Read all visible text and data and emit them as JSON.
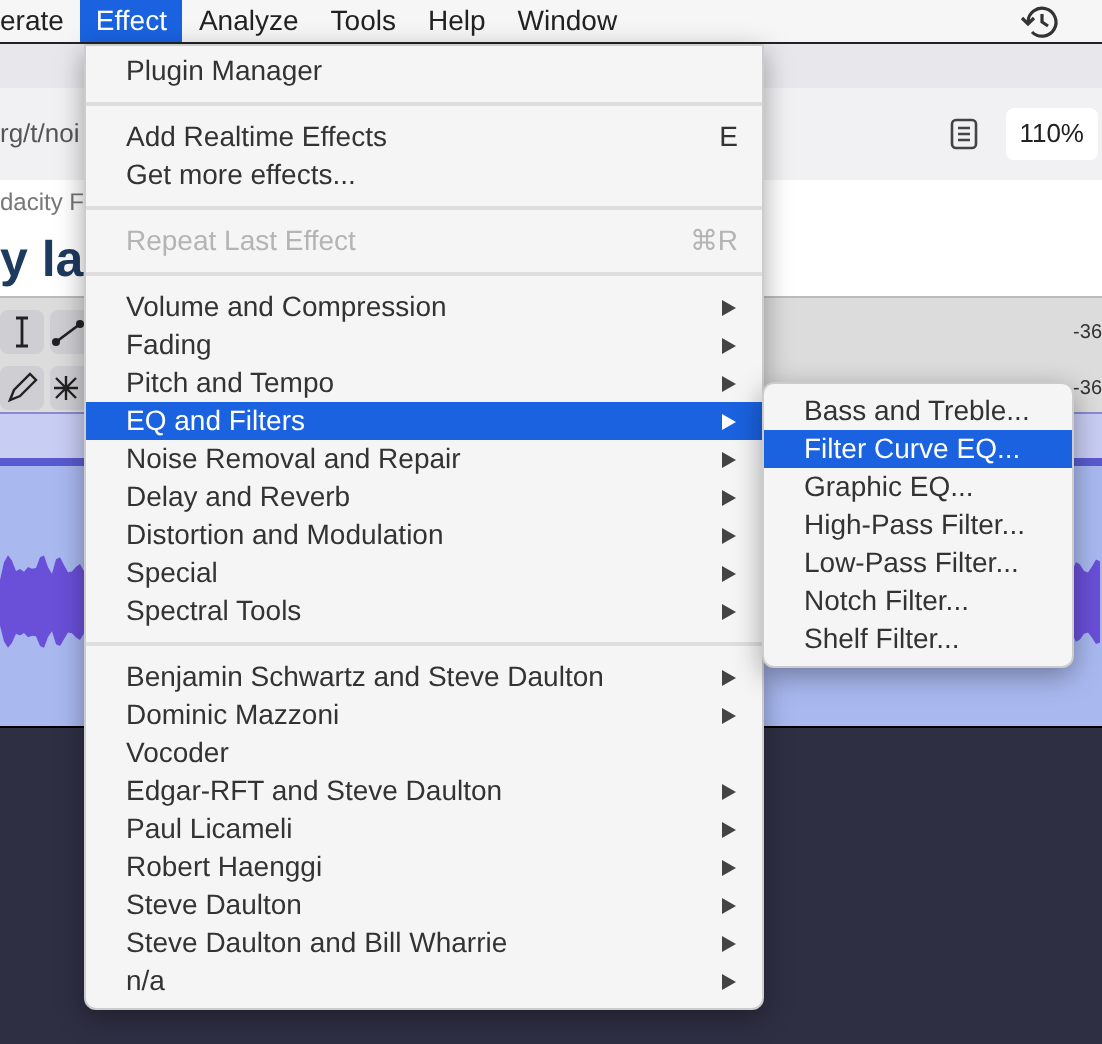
{
  "menubar": [
    {
      "label": "erate",
      "selected": false
    },
    {
      "label": "Effect",
      "selected": true
    },
    {
      "label": "Analyze",
      "selected": false
    },
    {
      "label": "Tools",
      "selected": false
    },
    {
      "label": "Help",
      "selected": false
    },
    {
      "label": "Window",
      "selected": false
    }
  ],
  "browser": {
    "url": "rg/t/noi",
    "zoom": "110%",
    "site_title": "dacity F",
    "heading": "y la"
  },
  "toolbar": {
    "meter_labels": [
      "-36",
      "-36"
    ]
  },
  "effect_menu": [
    {
      "kind": "item",
      "label": "Plugin Manager",
      "disabled": false,
      "submenu": false,
      "selected": false
    },
    {
      "kind": "separator"
    },
    {
      "kind": "item",
      "label": "Add Realtime Effects",
      "shortcut": "E",
      "disabled": false,
      "submenu": false,
      "selected": false
    },
    {
      "kind": "item",
      "label": "Get more effects...",
      "disabled": false,
      "submenu": false,
      "selected": false
    },
    {
      "kind": "separator"
    },
    {
      "kind": "item",
      "label": "Repeat Last Effect",
      "shortcut": "⌘R",
      "disabled": true,
      "submenu": false,
      "selected": false
    },
    {
      "kind": "separator"
    },
    {
      "kind": "item",
      "label": "Volume and Compression",
      "disabled": false,
      "submenu": true,
      "selected": false
    },
    {
      "kind": "item",
      "label": "Fading",
      "disabled": false,
      "submenu": true,
      "selected": false
    },
    {
      "kind": "item",
      "label": "Pitch and Tempo",
      "disabled": false,
      "submenu": true,
      "selected": false
    },
    {
      "kind": "item",
      "label": "EQ and Filters",
      "disabled": false,
      "submenu": true,
      "selected": true
    },
    {
      "kind": "item",
      "label": "Noise Removal and Repair",
      "disabled": false,
      "submenu": true,
      "selected": false
    },
    {
      "kind": "item",
      "label": "Delay and Reverb",
      "disabled": false,
      "submenu": true,
      "selected": false
    },
    {
      "kind": "item",
      "label": "Distortion and Modulation",
      "disabled": false,
      "submenu": true,
      "selected": false
    },
    {
      "kind": "item",
      "label": "Special",
      "disabled": false,
      "submenu": true,
      "selected": false
    },
    {
      "kind": "item",
      "label": "Spectral Tools",
      "disabled": false,
      "submenu": true,
      "selected": false
    },
    {
      "kind": "separator"
    },
    {
      "kind": "item",
      "label": "Benjamin Schwartz and Steve Daulton",
      "disabled": false,
      "submenu": true,
      "selected": false
    },
    {
      "kind": "item",
      "label": "Dominic Mazzoni",
      "disabled": false,
      "submenu": true,
      "selected": false
    },
    {
      "kind": "item",
      "label": "Vocoder",
      "disabled": false,
      "submenu": false,
      "selected": false
    },
    {
      "kind": "item",
      "label": "Edgar-RFT and Steve Daulton",
      "disabled": false,
      "submenu": true,
      "selected": false
    },
    {
      "kind": "item",
      "label": "Paul Licameli",
      "disabled": false,
      "submenu": true,
      "selected": false
    },
    {
      "kind": "item",
      "label": "Robert Haenggi",
      "disabled": false,
      "submenu": true,
      "selected": false
    },
    {
      "kind": "item",
      "label": "Steve Daulton",
      "disabled": false,
      "submenu": true,
      "selected": false
    },
    {
      "kind": "item",
      "label": "Steve Daulton and Bill Wharrie",
      "disabled": false,
      "submenu": true,
      "selected": false
    },
    {
      "kind": "item",
      "label": "n/a",
      "disabled": false,
      "submenu": true,
      "selected": false
    }
  ],
  "eq_submenu": [
    {
      "label": "Bass and Treble...",
      "selected": false
    },
    {
      "label": "Filter Curve EQ...",
      "selected": true
    },
    {
      "label": "Graphic EQ...",
      "selected": false
    },
    {
      "label": "High-Pass Filter...",
      "selected": false
    },
    {
      "label": "Low-Pass Filter...",
      "selected": false
    },
    {
      "label": "Notch Filter...",
      "selected": false
    },
    {
      "label": "Shelf Filter...",
      "selected": false
    }
  ]
}
